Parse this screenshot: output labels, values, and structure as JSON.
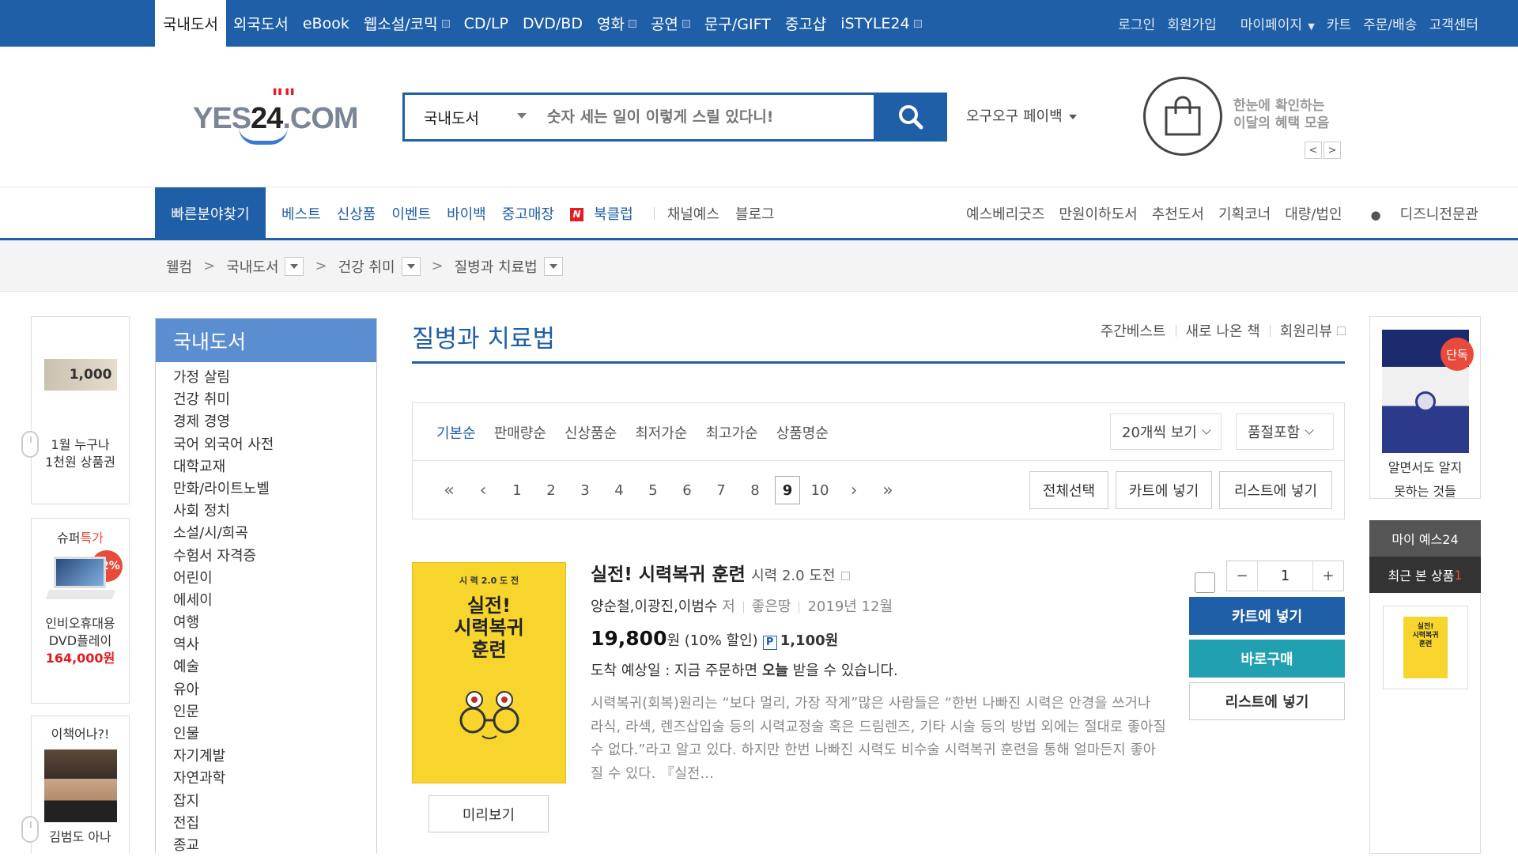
{
  "topnav": {
    "items": [
      {
        "label": "국내도서",
        "active": true,
        "sq": false
      },
      {
        "label": "외국도서",
        "sq": false
      },
      {
        "label": "eBook",
        "sq": false
      },
      {
        "label": "웹소설/코믹",
        "sq": true
      },
      {
        "label": "CD/LP",
        "sq": false
      },
      {
        "label": "DVD/BD",
        "sq": false
      },
      {
        "label": "영화",
        "sq": true
      },
      {
        "label": "공연",
        "sq": true
      },
      {
        "label": "문구/GIFT",
        "sq": false
      },
      {
        "label": "중고샵",
        "sq": false
      },
      {
        "label": "iSTYLE24",
        "sq": true
      }
    ],
    "util": [
      "로그인",
      "회원가입",
      "마이페이지",
      "카트",
      "주문/배송",
      "고객센터"
    ]
  },
  "logo": {
    "text_left": "YES",
    "text_mid": "24",
    "text_right": ".COM",
    "quote": "\"\""
  },
  "search": {
    "category": "국내도서",
    "placeholder": "숫자 세는 일이 이렇게 스릴 있다니!"
  },
  "payback": "오구오구 페이백",
  "benefit": {
    "line1": "한눈에 확인하는",
    "line2": "이달의 혜택 모음",
    "prev": "<",
    "next": ">"
  },
  "gnb": {
    "quick": "빠른분야찾기",
    "left": [
      "베스트",
      "신상품",
      "이벤트",
      "바이백",
      "중고매장"
    ],
    "bookclub": "북클럽",
    "left2": [
      "채널예스",
      "블로그"
    ],
    "right": [
      "예스베리굿즈",
      "만원이하도서",
      "추천도서",
      "기획코너",
      "대량/법인",
      "디즈니전문관"
    ]
  },
  "breadcrumb": {
    "home": "웰컴",
    "c1": "국내도서",
    "c2": "건강 취미",
    "c3": "질병과 치료법"
  },
  "left_banners": {
    "b1_amount": "1,000",
    "b1_line1": "1월 누구나",
    "b1_line2": "1천원 상품권",
    "b2_title_a": "슈퍼",
    "b2_title_b": "특가",
    "b2_disc": "12%",
    "b2_line1": "인비오휴대용",
    "b2_line2": "DVD플레이",
    "b2_price": "164,000원",
    "b3_title": "이책어나?!",
    "b3_name": "김범도 아나"
  },
  "category": {
    "title": "국내도서",
    "items": [
      "가정 살림",
      "건강 취미",
      "경제 경영",
      "국어 외국어 사전",
      "대학교재",
      "만화/라이트노벨",
      "사회 정치",
      "소설/시/희곡",
      "수험서 자격증",
      "어린이",
      "에세이",
      "여행",
      "역사",
      "예술",
      "유아",
      "인문",
      "인물",
      "자기계발",
      "자연과학",
      "잡지",
      "전집",
      "종교"
    ]
  },
  "page": {
    "title": "질병과 치료법",
    "links": [
      "주간베스트",
      "새로 나온 책",
      "회원리뷰"
    ]
  },
  "sorts": {
    "items": [
      "기본순",
      "판매량순",
      "신상품순",
      "최저가순",
      "최고가순",
      "상품명순"
    ],
    "per_page": "20개씩 보기",
    "stock": "품절포함"
  },
  "pager": {
    "pages": [
      "1",
      "2",
      "3",
      "4",
      "5",
      "6",
      "7",
      "8",
      "9",
      "10"
    ],
    "current": "9",
    "first": "«",
    "prev": "‹",
    "next": "›",
    "last": "»"
  },
  "actions": {
    "select_all": "전체선택",
    "cart": "카트에 넣기",
    "list": "리스트에 넣기"
  },
  "product": {
    "cover_series": "시 력 2.0 도 전",
    "cover_title_1": "실전!",
    "cover_title_2": "시력복귀",
    "cover_title_3": "훈련",
    "title": "실전! 시력복귀 훈련",
    "subtitle": "시력 2.0 도전",
    "authors": "양순철,이광진,이범수",
    "author_suffix": "저",
    "publisher": "좋은땅",
    "date": "2019년 12월",
    "price": "19,800",
    "price_unit": "원",
    "discount": "(10% 할인)",
    "points": "1,100원",
    "points_icon": "P",
    "delivery_prefix": "도착 예상일 : 지금 주문하면 ",
    "delivery_bold": "오늘",
    "delivery_suffix": " 받을 수 있습니다.",
    "desc": "시력복귀(회복)원리는 “보다 멀리, 가장 작게”많은 사람들은 “한번 나빠진 시력은 안경을 쓰거나 라식, 라섹, 렌즈삽입술 등의 시력교정술 혹은 드림렌즈, 기타 시술 등의 방법 외에는 절대로 좋아질 수 없다.”라고 알고 있다. 하지만 한번 나빠진 시력도 비수술 시력복귀 훈련을 통해 얼마든지 좋아질 수 있다. 『실전...",
    "preview": "미리보기",
    "qty": "1",
    "minus": "−",
    "plus": "+",
    "cart_btn": "카트에 넣기",
    "buy_btn": "바로구매",
    "list_btn": "리스트에 넣기"
  },
  "right": {
    "badge": "단독",
    "line1": "알면서도 알지",
    "line2": "못하는 것들",
    "my": "마이 예스24",
    "recent": "최근 본 상품",
    "recent_count": "1"
  },
  "colors": {
    "brand": "#1f5fa8",
    "accent": "#e31b23",
    "teal": "#20a0b0"
  }
}
